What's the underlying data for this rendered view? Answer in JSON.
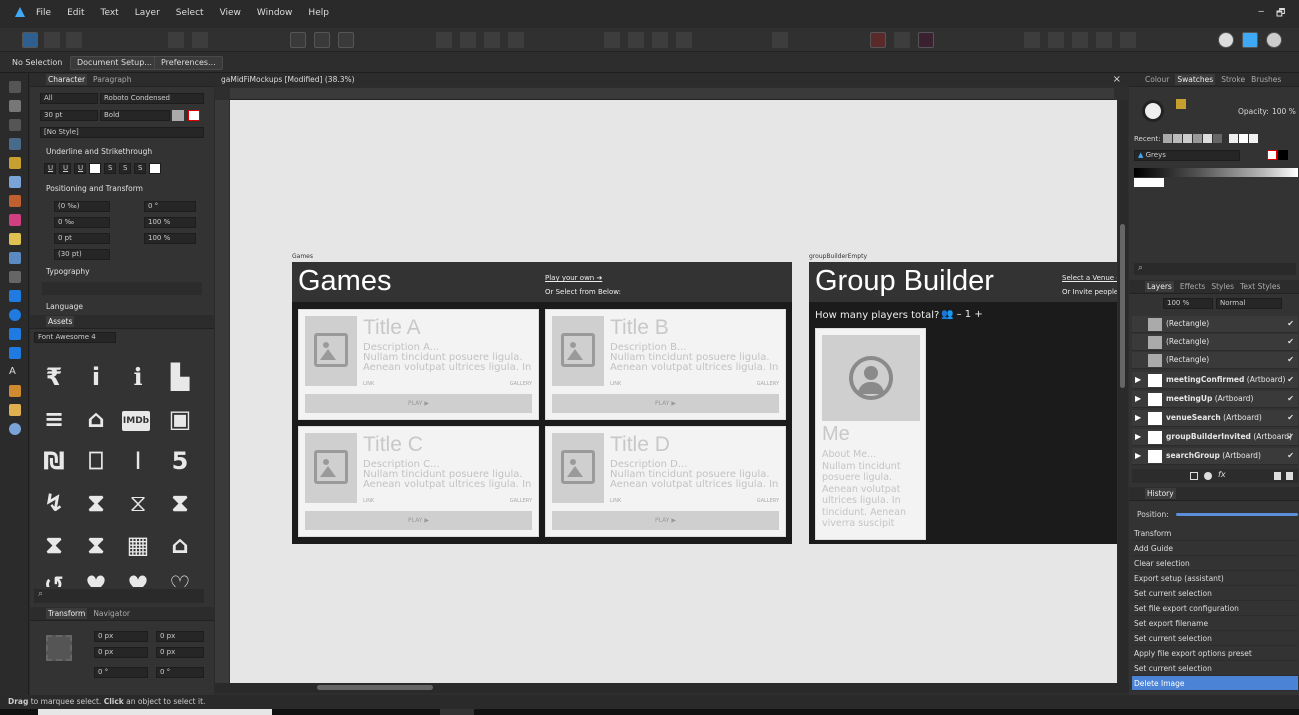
{
  "menubar": {
    "items": [
      "File",
      "Edit",
      "Text",
      "Layer",
      "Select",
      "View",
      "Window",
      "Help"
    ],
    "win_controls": [
      "‒",
      "🗗"
    ]
  },
  "context": {
    "selection": "No Selection",
    "doc_setup": "Document Setup...",
    "preferences": "Preferences..."
  },
  "left_panel": {
    "tabs": [
      "Character",
      "Paragraph"
    ],
    "font_scope": "All",
    "font_family": "Roboto Condensed",
    "font_size": "30 pt",
    "font_weight": "Bold",
    "style": "[No Style]",
    "underline_section": "Underline and Strikethrough",
    "underline_buttons": [
      "U",
      "U",
      "U",
      "S",
      "S",
      "S"
    ],
    "positioning_section": "Positioning and Transform",
    "pos_fields": {
      "kern": "(0 ‰)",
      "track": "0 ‰",
      "baseline": "0 pt",
      "leading": "(30 pt)",
      "rot": "0 °",
      "hscale": "100 %",
      "vscale": "100 %"
    },
    "typography_section": "Typography",
    "language_section": "Language",
    "assets_tab": "Assets",
    "assets_category": "Font Awesome 4",
    "asset_glyphs": [
      "₹",
      "i",
      "ℹ",
      "▙",
      "≡",
      "⌂",
      "IMDb",
      "▣",
      "₪",
      "⎕",
      "I",
      "5",
      "↯",
      "⧗",
      "⧖",
      "⧗",
      "⧗",
      "⧗",
      "▦",
      "⌂",
      "↺",
      "♥",
      "♥",
      "♡"
    ],
    "transform_tabs": [
      "Transform",
      "Navigator"
    ],
    "transform_fields": [
      "0 px",
      "0 px",
      "0 px",
      "0 px",
      "0 °",
      "0 °"
    ]
  },
  "document": {
    "tab_title": "gaMidFiMockups [Modified] (38.3%)",
    "close": "×"
  },
  "games_board": {
    "label": "Games",
    "title": "Games",
    "link1": "Play your own ➔",
    "link2": "Or Select from Below:",
    "cards": [
      {
        "title": "Title A",
        "desc": "Description A...",
        "body1": "Nullam tincidunt posuere ligula.",
        "body2": "Aenean volutpat ultrices ligula. In",
        "link": "LINK",
        "gallery": "GALLERY",
        "play": "PLAY ▶"
      },
      {
        "title": "Title B",
        "desc": "Description B...",
        "body1": "Nullam tincidunt posuere ligula.",
        "body2": "Aenean volutpat ultrices ligula. In",
        "link": "LINK",
        "gallery": "GALLERY",
        "play": "PLAY ▶"
      },
      {
        "title": "Title C",
        "desc": "Description C...",
        "body1": "Nullam tincidunt posuere ligula.",
        "body2": "Aenean volutpat ultrices ligula. In",
        "link": "LINK",
        "gallery": "GALLERY",
        "play": "PLAY ▶"
      },
      {
        "title": "Title D",
        "desc": "Description D...",
        "body1": "Nullam tincidunt posuere ligula.",
        "body2": "Aenean volutpat ultrices ligula. In",
        "link": "LINK",
        "gallery": "GALLERY",
        "play": "PLAY ▶"
      }
    ]
  },
  "group_board": {
    "label": "groupBuilderEmpty",
    "title": "Group Builder",
    "link1": "Select a Venue ➔",
    "link2": "Or Invite people",
    "question": "How many players total?",
    "stepper": "👥 – 1 +",
    "member_name": "Me",
    "member_about": "About Me...",
    "member_body": [
      "Nullam tincidunt",
      "posuere ligula.",
      "Aenean volutpat",
      "ultrices ligula. In",
      "tincidunt. Aenean",
      "viverra suscipit"
    ]
  },
  "right_panel": {
    "top_tabs": [
      "Colour",
      "Swatches",
      "Stroke",
      "Brushes"
    ],
    "opacity_label": "Opacity:",
    "opacity_value": "100 %",
    "recent_label": "Recent:",
    "palette": "Greys",
    "layer_tabs": [
      "Layers",
      "Effects",
      "Styles",
      "Text Styles"
    ],
    "layer_opacity": "100 %",
    "blend_mode": "Normal",
    "layers": [
      {
        "name": "(Rectangle)",
        "sub": "",
        "bold": false
      },
      {
        "name": "(Rectangle)",
        "sub": "",
        "bold": false
      },
      {
        "name": "(Rectangle)",
        "sub": "",
        "bold": false
      },
      {
        "name": "meetingConfirmed",
        "sub": "(Artboard)",
        "bold": true
      },
      {
        "name": "meetingUp",
        "sub": "(Artboard)",
        "bold": true
      },
      {
        "name": "venueSearch",
        "sub": "(Artboard)",
        "bold": true
      },
      {
        "name": "groupBuilderInvited",
        "sub": "(Artboard)",
        "bold": true
      },
      {
        "name": "searchGroup",
        "sub": "(Artboard)",
        "bold": true
      }
    ],
    "history_tab": "History",
    "position_label": "Position:",
    "history": [
      "Transform",
      "Add Guide",
      "Clear selection",
      "Export setup (assistant)",
      "Set current selection",
      "Set file export configuration",
      "Set export filename",
      "Set current selection",
      "Apply file export options preset",
      "Set current selection",
      "Delete Image"
    ]
  },
  "status": {
    "bold1": "Drag",
    "text1": " to marquee select. ",
    "bold2": "Click",
    "text2": " an object to select it."
  },
  "colors": {
    "accent": "#4b84d6",
    "brand": "#3fa9f5",
    "canvas": "#e6e6e6",
    "board": "#1b1b1b"
  }
}
